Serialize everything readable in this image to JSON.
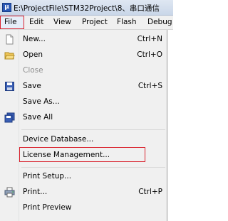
{
  "window": {
    "title": "E:\\ProjectFile\\STM32Project\\8、串口通信"
  },
  "menubar": {
    "items": [
      "File",
      "Edit",
      "View",
      "Project",
      "Flash",
      "Debug"
    ]
  },
  "file_menu": {
    "new": {
      "label": "New...",
      "shortcut": "Ctrl+N",
      "icon": "new-file-icon"
    },
    "open": {
      "label": "Open",
      "shortcut": "Ctrl+O",
      "icon": "open-folder-icon"
    },
    "close": {
      "label": "Close",
      "disabled": true
    },
    "save": {
      "label": "Save",
      "shortcut": "Ctrl+S",
      "icon": "save-icon"
    },
    "save_as": {
      "label": "Save As..."
    },
    "save_all": {
      "label": "Save All",
      "icon": "save-all-icon"
    },
    "device_database": {
      "label": "Device Database..."
    },
    "license_management": {
      "label": "License Management..."
    },
    "print_setup": {
      "label": "Print Setup..."
    },
    "print": {
      "label": "Print...",
      "shortcut": "Ctrl+P",
      "icon": "printer-icon"
    },
    "print_preview": {
      "label": "Print Preview"
    }
  },
  "colors": {
    "highlight_border": "#d9232e"
  }
}
